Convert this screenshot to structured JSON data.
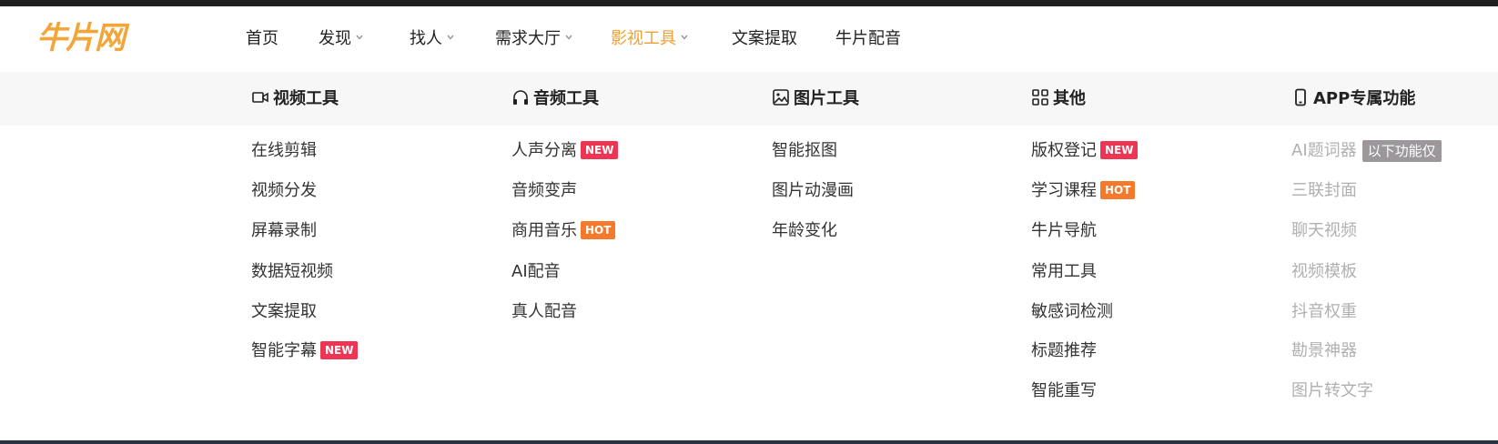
{
  "header": {
    "logo_text": "牛片网",
    "accent_color": "#f0a030",
    "nav": [
      {
        "label": "首页",
        "has_dropdown": false,
        "active": false
      },
      {
        "label": "发现",
        "has_dropdown": true,
        "active": false
      },
      {
        "label": "找人",
        "has_dropdown": true,
        "active": false
      },
      {
        "label": "需求大厅",
        "has_dropdown": true,
        "active": false
      },
      {
        "label": "影视工具",
        "has_dropdown": true,
        "active": true
      },
      {
        "label": "文案提取",
        "has_dropdown": false,
        "active": false
      },
      {
        "label": "牛片配音",
        "has_dropdown": false,
        "active": false
      }
    ]
  },
  "dropdown": {
    "columns": [
      {
        "title": "视频工具",
        "icon": "video-camera-icon",
        "items": [
          {
            "label": "在线剪辑"
          },
          {
            "label": "视频分发"
          },
          {
            "label": "屏幕录制"
          },
          {
            "label": "数据短视频"
          },
          {
            "label": "文案提取"
          },
          {
            "label": "智能字幕",
            "badge": "NEW"
          }
        ]
      },
      {
        "title": "音频工具",
        "icon": "headphones-icon",
        "items": [
          {
            "label": "人声分离",
            "badge": "NEW"
          },
          {
            "label": "音频变声"
          },
          {
            "label": "商用音乐",
            "badge": "HOT"
          },
          {
            "label": "AI配音"
          },
          {
            "label": "真人配音"
          }
        ]
      },
      {
        "title": "图片工具",
        "icon": "image-icon",
        "items": [
          {
            "label": "智能抠图"
          },
          {
            "label": "图片动漫画"
          },
          {
            "label": "年龄变化"
          }
        ]
      },
      {
        "title": "其他",
        "icon": "grid-icon",
        "items": [
          {
            "label": "版权登记",
            "badge": "NEW"
          },
          {
            "label": "学习课程",
            "badge": "HOT"
          },
          {
            "label": "牛片导航"
          },
          {
            "label": "常用工具"
          },
          {
            "label": "敏感词检测"
          },
          {
            "label": "标题推荐"
          },
          {
            "label": "智能重写"
          }
        ]
      },
      {
        "title": "APP专属功能",
        "icon": "phone-icon",
        "items": [
          {
            "label": "AI题词器",
            "badge": "以下功能仅"
          },
          {
            "label": "三联封面"
          },
          {
            "label": "聊天视频"
          },
          {
            "label": "视频模板"
          },
          {
            "label": "抖音权重"
          },
          {
            "label": "勘景神器"
          },
          {
            "label": "图片转文字"
          }
        ]
      }
    ]
  },
  "badge_colors": {
    "NEW": "#ee3554",
    "HOT": "#f5792a",
    "APP": "#9b979b"
  }
}
